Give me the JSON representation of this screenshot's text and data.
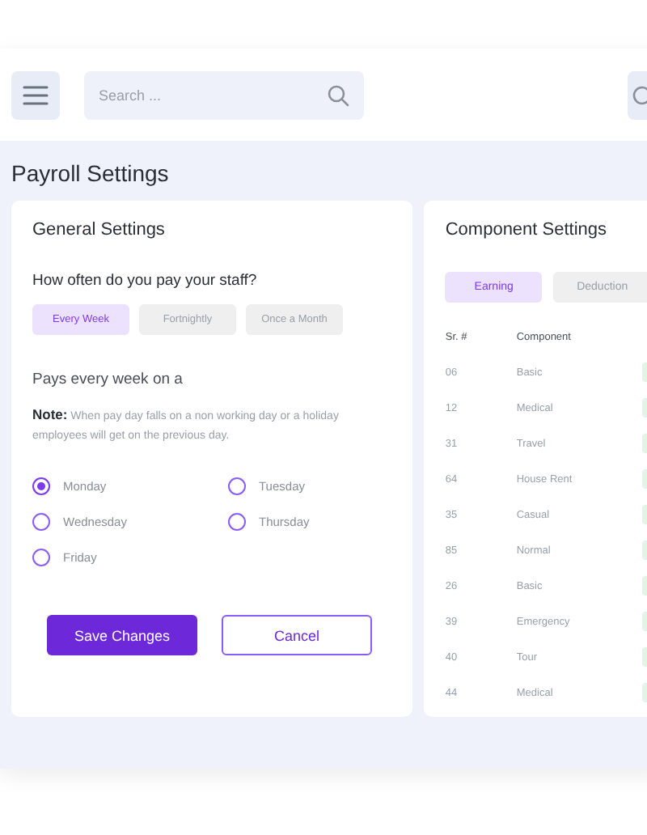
{
  "header": {
    "search": {
      "placeholder": "Search ..."
    }
  },
  "page_title": "Payroll Settings",
  "general_settings": {
    "title": "General Settings",
    "question": "How often do you pay your staff?",
    "frequency_options": [
      {
        "label": "Every Week",
        "selected": true
      },
      {
        "label": "Fortnightly",
        "selected": false
      },
      {
        "label": "Once a Month",
        "selected": false
      }
    ],
    "pay_day_label": "Pays every week on a",
    "note": "**Note:** When pay day falls on a non working day or a holiday employees will get on the previous day.",
    "days": [
      {
        "label": "Monday",
        "selected": true
      },
      {
        "label": "Tuesday",
        "selected": false
      },
      {
        "label": "Wednesday",
        "selected": false
      },
      {
        "label": "Thursday",
        "selected": false
      },
      {
        "label": "Friday",
        "selected": false
      }
    ],
    "buttons": [
      {
        "label": "Save Changes",
        "kind": "primary"
      },
      {
        "label": "Cancel",
        "kind": "secondary"
      }
    ]
  },
  "component_settings": {
    "title": "Component Settings",
    "tabs": [
      {
        "label": "Earning",
        "selected": true
      },
      {
        "label": "Deduction",
        "selected": false
      }
    ],
    "columns": [
      "Sr. #",
      "Component"
    ],
    "rows": [
      {
        "sr": "06",
        "component": "Basic"
      },
      {
        "sr": "12",
        "component": "Medical"
      },
      {
        "sr": "31",
        "component": "Travel"
      },
      {
        "sr": "64",
        "component": "House Rent"
      },
      {
        "sr": "35",
        "component": "Casual"
      },
      {
        "sr": "85",
        "component": "Normal"
      },
      {
        "sr": "26",
        "component": "Basic"
      },
      {
        "sr": "39",
        "component": "Emergency"
      },
      {
        "sr": "40",
        "component": "Tour"
      },
      {
        "sr": "44",
        "component": "Medical"
      }
    ]
  }
}
